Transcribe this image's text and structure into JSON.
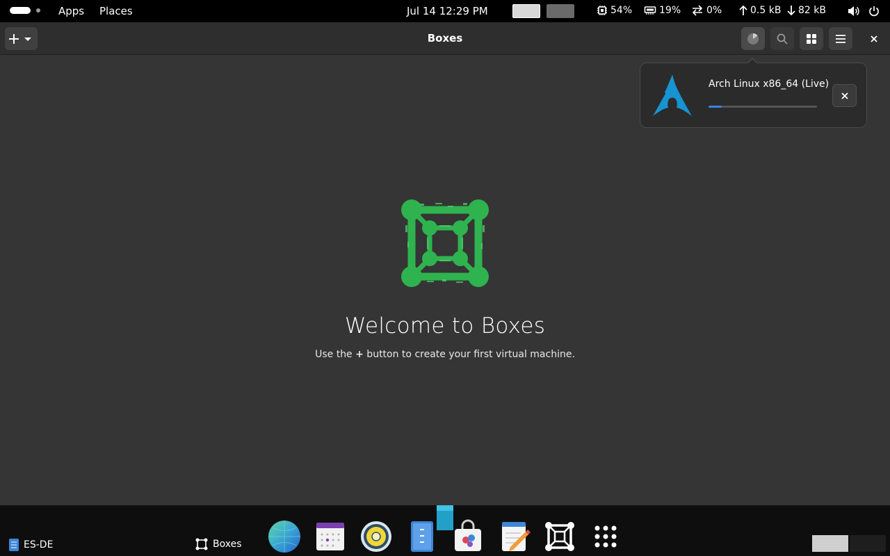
{
  "top_panel": {
    "apps": "Apps",
    "places": "Places",
    "clock": "Jul 14  12:29 PM",
    "cpu": "54%",
    "memory": "19%",
    "swap": "0%",
    "upload": "0.5 kB",
    "download": "82 kB"
  },
  "headerbar": {
    "title": "Boxes",
    "new_button_icon": "plus-icon",
    "downloads_icon": "progress-pie-icon",
    "search_icon": "search-icon",
    "view_icon": "grid-view-icon",
    "menu_icon": "hamburger-menu-icon",
    "close_icon": "close-icon"
  },
  "download": {
    "name": "Arch Linux x86_64 (Live)",
    "progress": 0.12,
    "logo_icon": "arch-linux-logo-icon"
  },
  "empty_state": {
    "title": "Welcome to Boxes",
    "sub_before": "Use the ",
    "sub_bold": "+",
    "sub_after": " button to create your first virtual machine."
  },
  "taskbar": {
    "left_app": "ES-DE",
    "window": "Boxes"
  },
  "dock": {
    "apps": [
      "browser-globe-icon",
      "calendar-icon",
      "speaker-icon",
      "text-editor-icon",
      "software-store-icon",
      "notes-icon",
      "boxes-icon",
      "app-grid-icon"
    ]
  },
  "colors": {
    "accent": "#3584e4",
    "boxes_green": "#2fb34f",
    "arch_blue": "#1793d1",
    "window_bg": "#353535"
  }
}
